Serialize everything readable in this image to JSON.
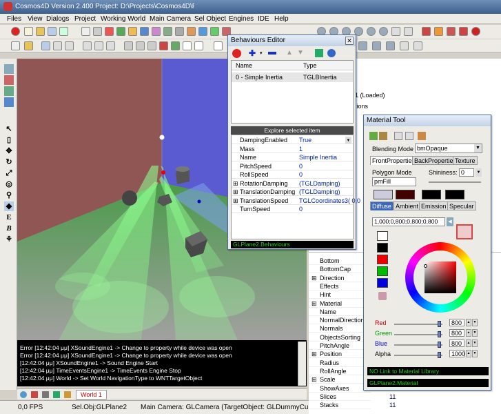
{
  "app": {
    "title": "Cosmos4D Version 2.400  Project: D:\\Projects\\Cosmos4D\\Projects\\Soft\\Shadows\\Volume1.C4D"
  },
  "menu": [
    "Files",
    "View",
    "Dialogs",
    "Project",
    "Working World",
    "Main Camera",
    "Sel Object",
    "Engines",
    "IDE",
    "Help"
  ],
  "log": {
    "lines": [
      "Error [12:42:04 μμ] XSoundEngine1 -> Change to property while device was open",
      "Error [12:42:04 μμ] XSoundEngine1 -> Change to property while device was open",
      "[12:42:04 μμ] XSoundEngine1 -> Sound Engine Start",
      "[12:42:04 μμ] TimeEventsEngine1 -> TimeEvents Engine Stop",
      "[12:42:04 μμ] World -> Set World NavigationType to WNTTargetObject"
    ]
  },
  "tabs": {
    "world": "World 1"
  },
  "status": {
    "fps": "0,0 FPS",
    "sel": "Sel.Obj:GLPlane2",
    "camera": "Main Camera: GLCamera (TargetObject: GLDummyCube2)"
  },
  "tree": {
    "loaded": "1  (Loaded)",
    "item2": "tions"
  },
  "props": [
    {
      "name": "Bottom",
      "val": ""
    },
    {
      "name": "BottomCap",
      "val": ""
    },
    {
      "name": "Direction",
      "val": "",
      "exp": true
    },
    {
      "name": "Effects",
      "val": ""
    },
    {
      "name": "Hint",
      "val": ""
    },
    {
      "name": "Material",
      "val": "",
      "exp": true
    },
    {
      "name": "Name",
      "val": ""
    },
    {
      "name": "NormalDirection",
      "val": ""
    },
    {
      "name": "Normals",
      "val": ""
    },
    {
      "name": "ObjectsSorting",
      "val": ""
    },
    {
      "name": "PitchAngle",
      "val": ""
    },
    {
      "name": "Position",
      "val": "",
      "exp": true
    },
    {
      "name": "Radius",
      "val": ""
    },
    {
      "name": "RollAngle",
      "val": ""
    },
    {
      "name": "Scale",
      "val": "",
      "exp": true
    },
    {
      "name": "ShowAxes",
      "val": ""
    },
    {
      "name": "Slices",
      "val": "11"
    },
    {
      "name": "Stacks",
      "val": "11"
    }
  ],
  "behaviours": {
    "title": "Behaviours Editor",
    "col_name": "Name",
    "col_type": "Type",
    "row_name": "0 - Simple Inertia",
    "row_type": "TGLBInertia",
    "explore": "Explore selected item",
    "grid": [
      {
        "name": "DampingEnabled",
        "val": "True"
      },
      {
        "name": "Mass",
        "val": "1"
      },
      {
        "name": "Name",
        "val": "Simple Inertia"
      },
      {
        "name": "PitchSpeed",
        "val": "0"
      },
      {
        "name": "RollSpeed",
        "val": "0"
      },
      {
        "name": "RotationDamping",
        "val": "(TGLDamping)",
        "exp": true
      },
      {
        "name": "TranslationDamping",
        "val": "(TGLDamping)",
        "exp": true
      },
      {
        "name": "TranslationSpeed",
        "val": "TGLCoordinates3( 0,0",
        "exp": true
      },
      {
        "name": "TurnSpeed",
        "val": "0"
      }
    ],
    "status": "GLPlane2.Behaviours"
  },
  "material": {
    "title": "Material Tool",
    "blend_label": "Blending Mode",
    "blend_val": "bmOpaque",
    "tabs": [
      "FrontProperties",
      "BackProperties",
      "Texture"
    ],
    "poly_label": "Polygon Mode",
    "poly_val": "pmFill",
    "shin_label": "Shininess:",
    "shin_val": "0",
    "color_tabs": [
      "Diffuse",
      "Ambient",
      "Emission",
      "Specular"
    ],
    "color_val": "1,000;0,800;0,800;0,800",
    "channels": [
      {
        "name": "Red",
        "val": "800",
        "color": "#cc0000"
      },
      {
        "name": "Green",
        "val": "800",
        "color": "#009900"
      },
      {
        "name": "Blue",
        "val": "800",
        "color": "#0000cc"
      },
      {
        "name": "Alpha",
        "val": "1000",
        "color": "#000000"
      }
    ],
    "lib": "NO Link to Material Library",
    "status": "GLPlane2.Material"
  }
}
